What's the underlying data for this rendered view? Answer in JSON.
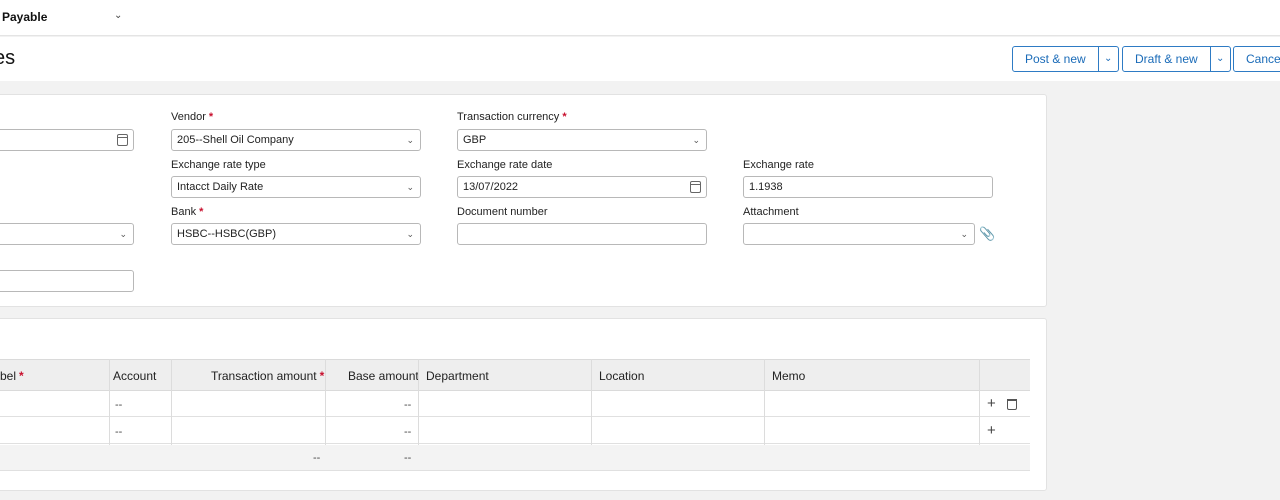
{
  "header": {
    "module": "s Payable",
    "page_title": "es"
  },
  "actions": {
    "post_new": "Post & new",
    "draft_new": "Draft & new",
    "cancel": "Cancel"
  },
  "form": {
    "vendor": {
      "label": "Vendor",
      "value": "205--Shell Oil Company"
    },
    "transaction_currency": {
      "label": "Transaction currency",
      "value": "GBP"
    },
    "exchange_rate_type": {
      "label": "Exchange rate type",
      "value": "Intacct Daily Rate"
    },
    "exchange_rate_date": {
      "label": "Exchange rate date",
      "value": "13/07/2022"
    },
    "exchange_rate": {
      "label": "Exchange rate",
      "value": "1.1938"
    },
    "bank": {
      "label": "Bank",
      "value": "HSBC--HSBC(GBP)"
    },
    "document_number": {
      "label": "Document number",
      "value": ""
    },
    "attachment": {
      "label": "Attachment",
      "value": ""
    }
  },
  "grid": {
    "columns": {
      "label": "bel",
      "account": "Account",
      "transaction_amount": "Transaction amount",
      "base_amount": "Base amount",
      "department": "Department",
      "location": "Location",
      "memo": "Memo"
    },
    "rows": [
      {
        "account": "--",
        "base_amount": "--"
      },
      {
        "account": "--",
        "base_amount": "--"
      }
    ],
    "totals": {
      "transaction_amount": "--",
      "base_amount": "--"
    }
  },
  "icons": {
    "add": "plus-icon",
    "delete": "trash-icon",
    "calendar": "calendar-icon",
    "attach": "paperclip-icon",
    "dropdown": "chevron-down-icon"
  }
}
